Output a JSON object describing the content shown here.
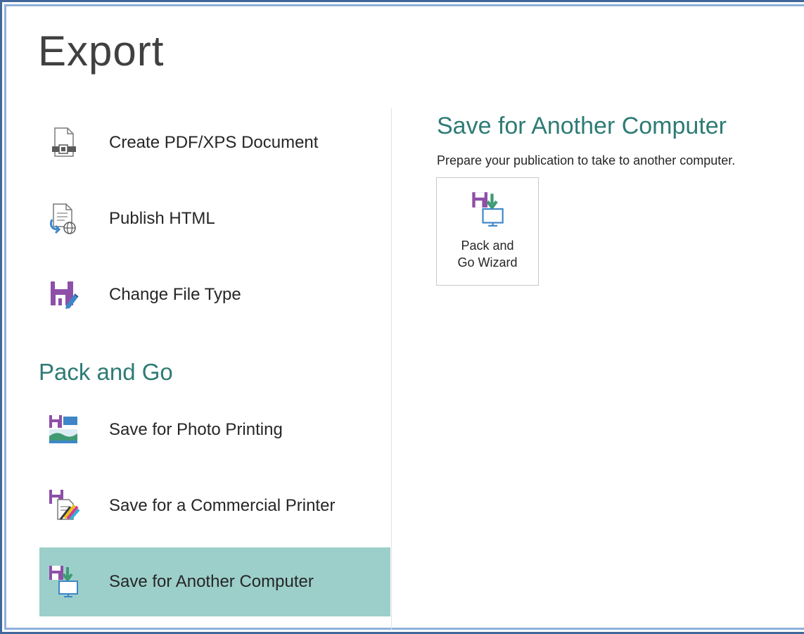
{
  "page": {
    "title": "Export"
  },
  "nav": {
    "items": [
      {
        "label": "Create PDF/XPS Document",
        "icon": "pdf-xps-document-icon"
      },
      {
        "label": "Publish HTML",
        "icon": "publish-html-icon"
      },
      {
        "label": "Change File Type",
        "icon": "change-file-type-icon"
      }
    ],
    "section_heading": "Pack and Go",
    "pack_items": [
      {
        "label": "Save for Photo Printing",
        "icon": "photo-printing-icon"
      },
      {
        "label": "Save for a Commercial Printer",
        "icon": "commercial-printer-icon"
      },
      {
        "label": "Save for Another Computer",
        "icon": "another-computer-icon",
        "selected": true
      }
    ]
  },
  "detail": {
    "title": "Save for Another Computer",
    "description": "Prepare your publication to take to another computer.",
    "wizard_button": {
      "line1": "Pack and",
      "line2": "Go Wizard",
      "icon": "pack-and-go-wizard-icon"
    }
  },
  "colors": {
    "accent": "#2e7b75",
    "selected_bg": "#9ccfca",
    "frame_outer": "#41689a",
    "frame_inner": "#8fb1dc",
    "disk_purple": "#8e4fa8",
    "arrow_green": "#3f9a74",
    "monitor_blue": "#3e86c8"
  }
}
